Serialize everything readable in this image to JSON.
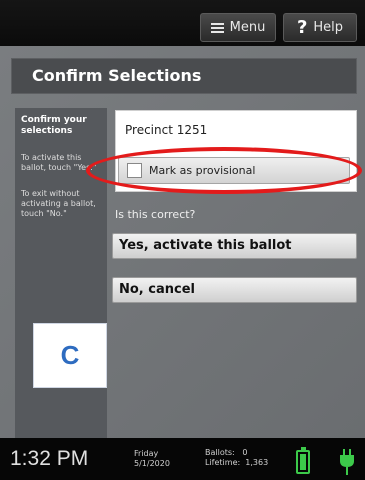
{
  "toolbar": {
    "menu_label": "Menu",
    "help_label": "Help",
    "help_icon_glyph": "?"
  },
  "page": {
    "title": "Confirm Selections"
  },
  "sidebar": {
    "heading": "Confirm your selections",
    "instruction_yes": "To activate this ballot, touch \"Yes.\"",
    "instruction_no": "To exit without activating a ballot, touch \"No.\""
  },
  "selection": {
    "precinct": "Precinct 1251",
    "provisional_label": "Mark as provisional",
    "provisional_checked": false
  },
  "confirm": {
    "question": "Is this correct?",
    "yes_label": "Yes, activate this ballot",
    "no_label": "No, cancel"
  },
  "annotation": {
    "label": "C",
    "highlight_color": "#e31b1b"
  },
  "status": {
    "time": "1:32 PM",
    "day": "Friday",
    "date": "5/1/2020",
    "ballots_label": "Ballots:",
    "ballots_value": "0",
    "lifetime_label": "Lifetime:",
    "lifetime_value": "1,363",
    "battery_color": "#3cc94a"
  }
}
